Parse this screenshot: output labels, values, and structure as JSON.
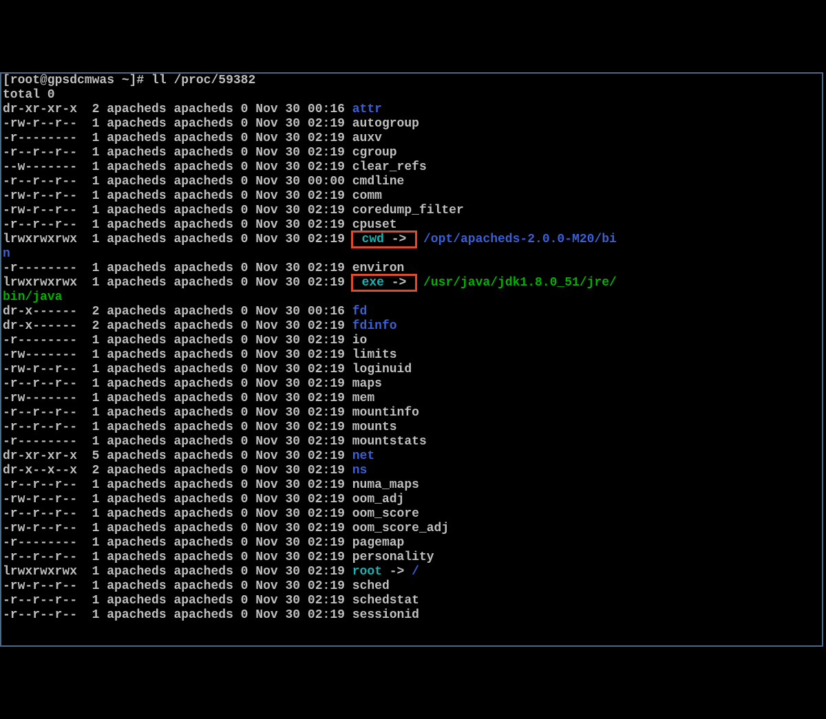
{
  "prompt": "[root@gpsdcmwas ~]# ",
  "command": "ll /proc/59382",
  "total_line": "total 0",
  "rows": [
    {
      "perm": "dr-xr-xr-x",
      "l": "2",
      "u": "apacheds",
      "g": "apacheds",
      "s": "0",
      "m": "Nov",
      "d": "30",
      "t": "00:16",
      "name": "attr",
      "name_color": "blue"
    },
    {
      "perm": "-rw-r--r--",
      "l": "1",
      "u": "apacheds",
      "g": "apacheds",
      "s": "0",
      "m": "Nov",
      "d": "30",
      "t": "02:19",
      "name": "autogroup",
      "name_color": "default"
    },
    {
      "perm": "-r--------",
      "l": "1",
      "u": "apacheds",
      "g": "apacheds",
      "s": "0",
      "m": "Nov",
      "d": "30",
      "t": "02:19",
      "name": "auxv",
      "name_color": "default"
    },
    {
      "perm": "-r--r--r--",
      "l": "1",
      "u": "apacheds",
      "g": "apacheds",
      "s": "0",
      "m": "Nov",
      "d": "30",
      "t": "02:19",
      "name": "cgroup",
      "name_color": "default"
    },
    {
      "perm": "--w-------",
      "l": "1",
      "u": "apacheds",
      "g": "apacheds",
      "s": "0",
      "m": "Nov",
      "d": "30",
      "t": "02:19",
      "name": "clear_refs",
      "name_color": "default"
    },
    {
      "perm": "-r--r--r--",
      "l": "1",
      "u": "apacheds",
      "g": "apacheds",
      "s": "0",
      "m": "Nov",
      "d": "30",
      "t": "00:00",
      "name": "cmdline",
      "name_color": "default"
    },
    {
      "perm": "-rw-r--r--",
      "l": "1",
      "u": "apacheds",
      "g": "apacheds",
      "s": "0",
      "m": "Nov",
      "d": "30",
      "t": "02:19",
      "name": "comm",
      "name_color": "default"
    },
    {
      "perm": "-rw-r--r--",
      "l": "1",
      "u": "apacheds",
      "g": "apacheds",
      "s": "0",
      "m": "Nov",
      "d": "30",
      "t": "02:19",
      "name": "coredump_filter",
      "name_color": "default"
    },
    {
      "perm": "-r--r--r--",
      "l": "1",
      "u": "apacheds",
      "g": "apacheds",
      "s": "0",
      "m": "Nov",
      "d": "30",
      "t": "02:19",
      "name": "cpuset",
      "name_color": "default"
    },
    {
      "perm": "lrwxrwxrwx",
      "l": "1",
      "u": "apacheds",
      "g": "apacheds",
      "s": "0",
      "m": "Nov",
      "d": "30",
      "t": "02:19",
      "name": "cwd",
      "name_color": "cyan",
      "arrow": " -> ",
      "boxed": true,
      "target": "/opt/apacheds-2.0.0-M20/bi",
      "target_color": "blue",
      "wrap": "n",
      "wrap_color": "blue"
    },
    {
      "perm": "-r--------",
      "l": "1",
      "u": "apacheds",
      "g": "apacheds",
      "s": "0",
      "m": "Nov",
      "d": "30",
      "t": "02:19",
      "name": "environ",
      "name_color": "default"
    },
    {
      "perm": "lrwxrwxrwx",
      "l": "1",
      "u": "apacheds",
      "g": "apacheds",
      "s": "0",
      "m": "Nov",
      "d": "30",
      "t": "02:19",
      "name": "exe",
      "name_color": "cyan",
      "arrow": " -> ",
      "boxed": true,
      "target": "/usr/java/jdk1.8.0_51/jre/",
      "target_color": "green",
      "wrap": "bin/java",
      "wrap_color": "green"
    },
    {
      "perm": "dr-x------",
      "l": "2",
      "u": "apacheds",
      "g": "apacheds",
      "s": "0",
      "m": "Nov",
      "d": "30",
      "t": "00:16",
      "name": "fd",
      "name_color": "blue"
    },
    {
      "perm": "dr-x------",
      "l": "2",
      "u": "apacheds",
      "g": "apacheds",
      "s": "0",
      "m": "Nov",
      "d": "30",
      "t": "02:19",
      "name": "fdinfo",
      "name_color": "blue"
    },
    {
      "perm": "-r--------",
      "l": "1",
      "u": "apacheds",
      "g": "apacheds",
      "s": "0",
      "m": "Nov",
      "d": "30",
      "t": "02:19",
      "name": "io",
      "name_color": "default"
    },
    {
      "perm": "-rw-------",
      "l": "1",
      "u": "apacheds",
      "g": "apacheds",
      "s": "0",
      "m": "Nov",
      "d": "30",
      "t": "02:19",
      "name": "limits",
      "name_color": "default"
    },
    {
      "perm": "-rw-r--r--",
      "l": "1",
      "u": "apacheds",
      "g": "apacheds",
      "s": "0",
      "m": "Nov",
      "d": "30",
      "t": "02:19",
      "name": "loginuid",
      "name_color": "default"
    },
    {
      "perm": "-r--r--r--",
      "l": "1",
      "u": "apacheds",
      "g": "apacheds",
      "s": "0",
      "m": "Nov",
      "d": "30",
      "t": "02:19",
      "name": "maps",
      "name_color": "default"
    },
    {
      "perm": "-rw-------",
      "l": "1",
      "u": "apacheds",
      "g": "apacheds",
      "s": "0",
      "m": "Nov",
      "d": "30",
      "t": "02:19",
      "name": "mem",
      "name_color": "default"
    },
    {
      "perm": "-r--r--r--",
      "l": "1",
      "u": "apacheds",
      "g": "apacheds",
      "s": "0",
      "m": "Nov",
      "d": "30",
      "t": "02:19",
      "name": "mountinfo",
      "name_color": "default"
    },
    {
      "perm": "-r--r--r--",
      "l": "1",
      "u": "apacheds",
      "g": "apacheds",
      "s": "0",
      "m": "Nov",
      "d": "30",
      "t": "02:19",
      "name": "mounts",
      "name_color": "default"
    },
    {
      "perm": "-r--------",
      "l": "1",
      "u": "apacheds",
      "g": "apacheds",
      "s": "0",
      "m": "Nov",
      "d": "30",
      "t": "02:19",
      "name": "mountstats",
      "name_color": "default"
    },
    {
      "perm": "dr-xr-xr-x",
      "l": "5",
      "u": "apacheds",
      "g": "apacheds",
      "s": "0",
      "m": "Nov",
      "d": "30",
      "t": "02:19",
      "name": "net",
      "name_color": "blue"
    },
    {
      "perm": "dr-x--x--x",
      "l": "2",
      "u": "apacheds",
      "g": "apacheds",
      "s": "0",
      "m": "Nov",
      "d": "30",
      "t": "02:19",
      "name": "ns",
      "name_color": "blue"
    },
    {
      "perm": "-r--r--r--",
      "l": "1",
      "u": "apacheds",
      "g": "apacheds",
      "s": "0",
      "m": "Nov",
      "d": "30",
      "t": "02:19",
      "name": "numa_maps",
      "name_color": "default"
    },
    {
      "perm": "-rw-r--r--",
      "l": "1",
      "u": "apacheds",
      "g": "apacheds",
      "s": "0",
      "m": "Nov",
      "d": "30",
      "t": "02:19",
      "name": "oom_adj",
      "name_color": "default"
    },
    {
      "perm": "-r--r--r--",
      "l": "1",
      "u": "apacheds",
      "g": "apacheds",
      "s": "0",
      "m": "Nov",
      "d": "30",
      "t": "02:19",
      "name": "oom_score",
      "name_color": "default"
    },
    {
      "perm": "-rw-r--r--",
      "l": "1",
      "u": "apacheds",
      "g": "apacheds",
      "s": "0",
      "m": "Nov",
      "d": "30",
      "t": "02:19",
      "name": "oom_score_adj",
      "name_color": "default"
    },
    {
      "perm": "-r--------",
      "l": "1",
      "u": "apacheds",
      "g": "apacheds",
      "s": "0",
      "m": "Nov",
      "d": "30",
      "t": "02:19",
      "name": "pagemap",
      "name_color": "default"
    },
    {
      "perm": "-r--r--r--",
      "l": "1",
      "u": "apacheds",
      "g": "apacheds",
      "s": "0",
      "m": "Nov",
      "d": "30",
      "t": "02:19",
      "name": "personality",
      "name_color": "default"
    },
    {
      "perm": "lrwxrwxrwx",
      "l": "1",
      "u": "apacheds",
      "g": "apacheds",
      "s": "0",
      "m": "Nov",
      "d": "30",
      "t": "02:19",
      "name": "root",
      "name_color": "cyan",
      "arrow": " -> ",
      "target": "/",
      "target_color": "blue"
    },
    {
      "perm": "-rw-r--r--",
      "l": "1",
      "u": "apacheds",
      "g": "apacheds",
      "s": "0",
      "m": "Nov",
      "d": "30",
      "t": "02:19",
      "name": "sched",
      "name_color": "default"
    },
    {
      "perm": "-r--r--r--",
      "l": "1",
      "u": "apacheds",
      "g": "apacheds",
      "s": "0",
      "m": "Nov",
      "d": "30",
      "t": "02:19",
      "name": "schedstat",
      "name_color": "default"
    },
    {
      "perm": "-r--r--r--",
      "l": "1",
      "u": "apacheds",
      "g": "apacheds",
      "s": "0",
      "m": "Nov",
      "d": "30",
      "t": "02:19",
      "name": "sessionid",
      "name_color": "default"
    }
  ]
}
